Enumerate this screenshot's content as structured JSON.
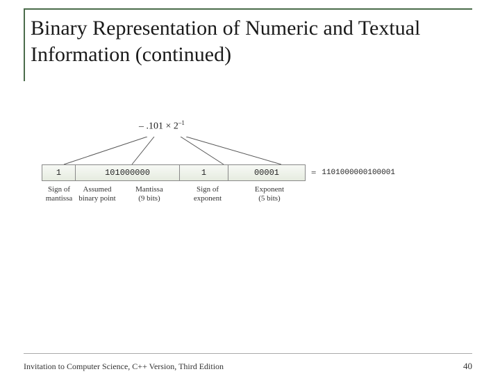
{
  "title": "Binary Representation of Numeric and Textual Information (continued)",
  "expression": {
    "prefix": "– .101 × 2",
    "exp": "–1"
  },
  "fields": {
    "sign_mantissa": "1",
    "mantissa": "101000000",
    "sign_exponent": "1",
    "exponent": "00001"
  },
  "labels": {
    "sign_mantissa": "Sign of\nmantissa",
    "binary_point": "Assumed\nbinary point",
    "mantissa": "Mantissa\n(9 bits)",
    "sign_exponent": "Sign of\nexponent",
    "exponent": "Exponent\n(5 bits)"
  },
  "concat": "1101000000100001",
  "eq": "=",
  "footer": {
    "left": "Invitation to Computer Science, C++ Version, Third Edition",
    "page": "40"
  }
}
